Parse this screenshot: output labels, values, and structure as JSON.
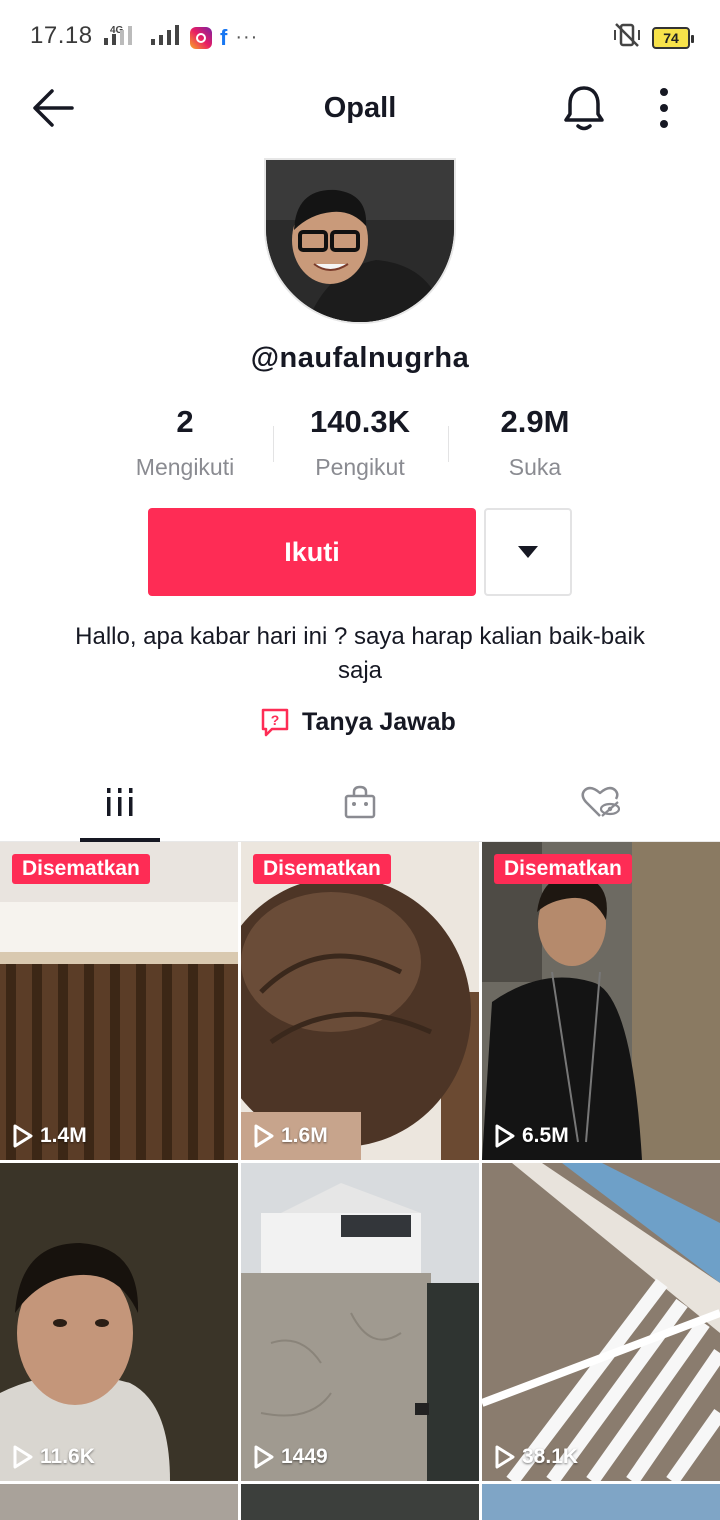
{
  "status_bar": {
    "time": "17.18",
    "network": "4G",
    "battery": "74",
    "more": "···"
  },
  "header": {
    "title": "Opall"
  },
  "profile": {
    "username": "@naufalnugrha",
    "stats": [
      {
        "value": "2",
        "label": "Mengikuti"
      },
      {
        "value": "140.3K",
        "label": "Pengikut"
      },
      {
        "value": "2.9M",
        "label": "Suka"
      }
    ],
    "follow_label": "Ikuti",
    "bio": "Hallo, apa kabar hari ini ? saya harap kalian baik-baik saja",
    "qa_label": "Tanya Jawab"
  },
  "tabs": [
    {
      "icon": "videos-grid-icon",
      "active": true
    },
    {
      "icon": "shop-bag-icon",
      "active": false
    },
    {
      "icon": "liked-hidden-icon",
      "active": false
    }
  ],
  "videos": [
    {
      "pinned_label": "Disematkan",
      "views": "1.4M",
      "scene": "curtain"
    },
    {
      "pinned_label": "Disematkan",
      "views": "1.6M",
      "scene": "hair-closeup"
    },
    {
      "pinned_label": "Disematkan",
      "views": "6.5M",
      "scene": "person-black-shirt"
    },
    {
      "pinned_label": "",
      "views": "11.6K",
      "scene": "person-dark-room"
    },
    {
      "pinned_label": "",
      "views": "1449",
      "scene": "white-house"
    },
    {
      "pinned_label": "",
      "views": "38.1K",
      "scene": "white-fence"
    }
  ],
  "colors": {
    "accent": "#fe2c55",
    "text": "#161823",
    "secondary_text": "#8a8b91"
  }
}
